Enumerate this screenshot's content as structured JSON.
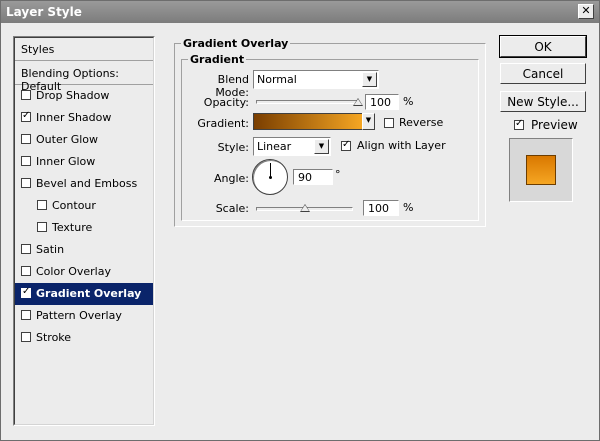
{
  "window": {
    "title": "Layer Style",
    "close_glyph": "✕"
  },
  "styles_list": {
    "header": "Styles",
    "blending": "Blending Options: Default",
    "items": [
      {
        "label": "Drop Shadow",
        "checked": false,
        "indent": false,
        "active": false
      },
      {
        "label": "Inner Shadow",
        "checked": true,
        "indent": false,
        "active": false
      },
      {
        "label": "Outer Glow",
        "checked": false,
        "indent": false,
        "active": false
      },
      {
        "label": "Inner Glow",
        "checked": false,
        "indent": false,
        "active": false
      },
      {
        "label": "Bevel and Emboss",
        "checked": false,
        "indent": false,
        "active": false
      },
      {
        "label": "Contour",
        "checked": false,
        "indent": true,
        "active": false
      },
      {
        "label": "Texture",
        "checked": false,
        "indent": true,
        "active": false
      },
      {
        "label": "Satin",
        "checked": false,
        "indent": false,
        "active": false
      },
      {
        "label": "Color Overlay",
        "checked": false,
        "indent": false,
        "active": false
      },
      {
        "label": "Gradient Overlay",
        "checked": true,
        "indent": false,
        "active": true
      },
      {
        "label": "Pattern Overlay",
        "checked": false,
        "indent": false,
        "active": false
      },
      {
        "label": "Stroke",
        "checked": false,
        "indent": false,
        "active": false
      }
    ]
  },
  "panel": {
    "group_title": "Gradient Overlay",
    "sub_title": "Gradient",
    "blend_mode": {
      "label": "Blend Mode:",
      "value": "Normal"
    },
    "opacity": {
      "label": "Opacity:",
      "value": "100",
      "unit": "%",
      "level": 1.0
    },
    "gradient": {
      "label": "Gradient:",
      "color_start": "#7a3e00",
      "color_end": "#f5a623"
    },
    "reverse": {
      "label": "Reverse",
      "checked": false
    },
    "style": {
      "label": "Style:",
      "value": "Linear"
    },
    "align": {
      "label": "Align with Layer",
      "checked": true
    },
    "angle": {
      "label": "Angle:",
      "value": "90",
      "unit": "°",
      "degrees": 90
    },
    "scale": {
      "label": "Scale:",
      "value": "100",
      "unit": "%",
      "level": 0.5
    }
  },
  "buttons": {
    "ok": "OK",
    "cancel": "Cancel",
    "new_style": "New Style..."
  },
  "preview": {
    "label": "Preview",
    "checked": true,
    "color_start": "#d97800",
    "color_end": "#f5a623"
  },
  "colors": {
    "selection": "#0a246a",
    "titlebar": "#8a8a8a"
  }
}
